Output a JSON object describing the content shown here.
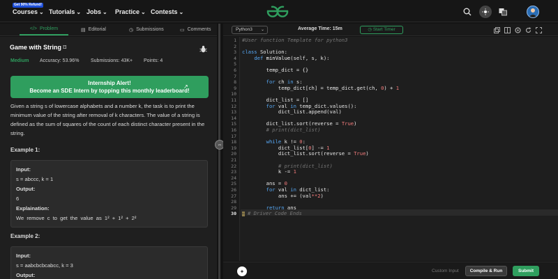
{
  "topnav": {
    "promo": "Get 90% Refund!",
    "items": [
      {
        "label": "Courses"
      },
      {
        "label": "Tutorials"
      },
      {
        "label": "Jobs"
      },
      {
        "label": "Practice"
      },
      {
        "label": "Contests"
      }
    ],
    "brand_color": "#2f9e5e"
  },
  "problem_tabs": {
    "problem": "Problem",
    "editorial": "Editorial",
    "submissions": "Submissions",
    "comments": "Comments"
  },
  "problem": {
    "title": "Game with String",
    "difficulty": "Medium",
    "accuracy": "Accuracy: 53.96%",
    "submissions": "Submissions: 43K+",
    "points": "Points: 4",
    "alert_line1": "Internship Alert!",
    "alert_line2": "Become an SDE Intern by topping this monthly leaderboard!",
    "description": "Given a string s of lowercase alphabets and a number k, the task is to print the minimum value of the string after removal of k characters. The value of a string is defined as the sum of squares of the count of each distinct character present in the string.",
    "example1_heading": "Example 1:",
    "example1_input_label": "Input:",
    "example1_input": "s = abccc, k = 1",
    "example1_output_label": "Output:",
    "example1_output": "6",
    "example1_expl_label": "Explaination:",
    "example1_expl": "We remove c to get the value as 1² + 1² + 2²",
    "example2_heading": "Example 2:",
    "example2_input_label": "Input:",
    "example2_input": "s = aabcbcbcabcc, k = 3",
    "example2_output_label": "Output:"
  },
  "editor": {
    "language": "Python3",
    "avg_time": "Average Time: 15m",
    "start_timer": "Start Timer",
    "line_numbers": [
      "1",
      "2",
      "3",
      "4",
      "5",
      "6",
      "7",
      "8",
      "9",
      "10",
      "11",
      "12",
      "13",
      "14",
      "15",
      "16",
      "17",
      "18",
      "19",
      "20",
      "21",
      "22",
      "23",
      "24",
      "25",
      "26",
      "27",
      "28",
      "29",
      "30"
    ],
    "fold_marker": "⋯",
    "last_line_comment": "# Driver Code Ends"
  },
  "bottom": {
    "custom_input": "Custom Input",
    "compile": "Compile & Run",
    "submit": "Submit"
  }
}
